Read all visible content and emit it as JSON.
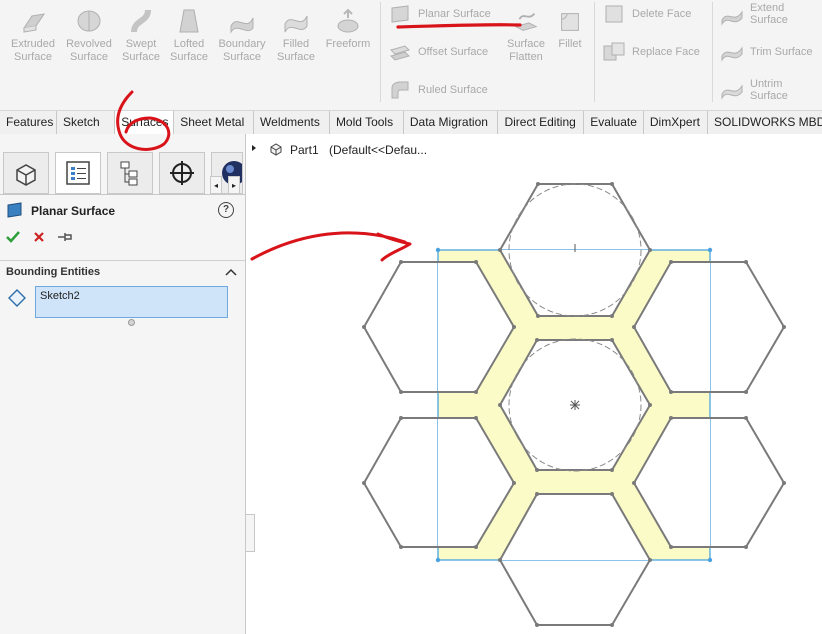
{
  "ribbon": {
    "buttons": [
      {
        "line1": "Extruded",
        "line2": "Surface"
      },
      {
        "line1": "Revolved",
        "line2": "Surface"
      },
      {
        "line1": "Swept",
        "line2": "Surface"
      },
      {
        "line1": "Lofted",
        "line2": "Surface"
      },
      {
        "line1": "Boundary",
        "line2": "Surface"
      },
      {
        "line1": "Filled",
        "line2": "Surface"
      },
      {
        "line1": "Freeform",
        "line2": ""
      }
    ],
    "planar_surface": "Planar Surface",
    "offset_surface": "Offset Surface",
    "ruled_surface": "Ruled Surface",
    "surface_flatten_1": "Surface",
    "surface_flatten_2": "Flatten",
    "fillet": "Fillet",
    "delete_face": "Delete Face",
    "replace_face": "Replace Face",
    "extend_surface": "Extend Surface",
    "trim_surface": "Trim Surface",
    "untrim_surface": "Untrim Surface"
  },
  "tabs": [
    "Features",
    "Sketch",
    "Surfaces",
    "Sheet Metal",
    "Weldments",
    "Mold Tools",
    "Data Migration",
    "Direct Editing",
    "Evaluate",
    "DimXpert",
    "SOLIDWORKS MBD"
  ],
  "active_tab": "Surfaces",
  "panel": {
    "title": "Planar Surface",
    "help": "?",
    "section": "Bounding Entities",
    "entity": "Sketch2"
  },
  "tree": {
    "part": "Part1",
    "config": "(Default<<Defau..."
  },
  "colors": {
    "annotation": "#d8141a",
    "surface_fill": "#fbfbc7",
    "selection": "#4aa3e0",
    "accept": "#2f9e3a",
    "cancel": "#cc2222",
    "sketch": "#7a7a7a"
  }
}
